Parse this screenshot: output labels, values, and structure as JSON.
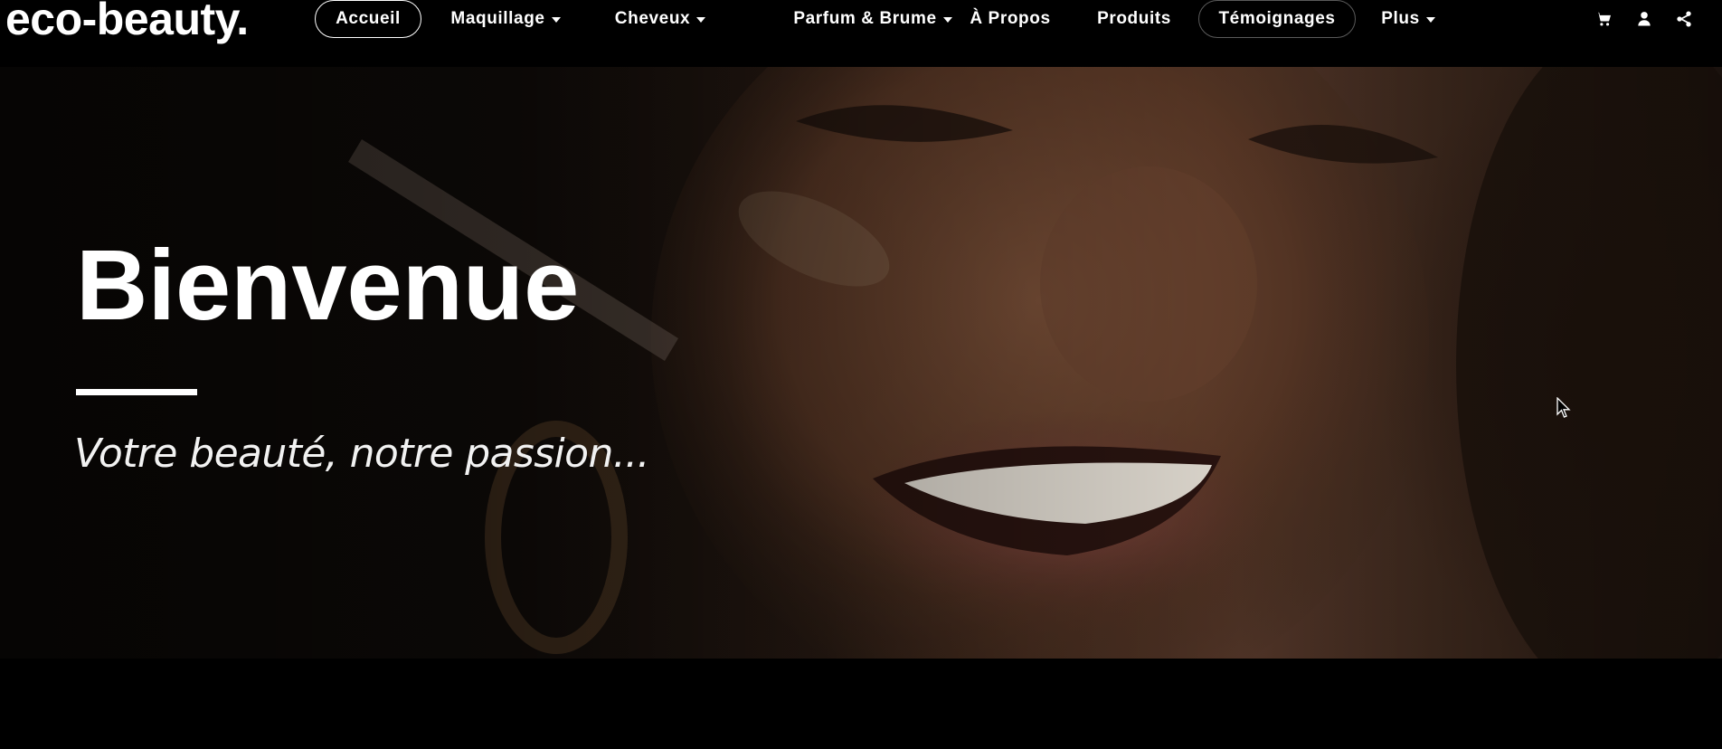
{
  "brand": {
    "logo": "eco-beauty."
  },
  "nav": {
    "items": [
      {
        "label": "Accueil",
        "active": true
      },
      {
        "label": "Maquillage",
        "dropdown": true
      },
      {
        "label": "Cheveux",
        "dropdown": true
      },
      {
        "label": "Parfum & Brume",
        "dropdown": true
      },
      {
        "label": "À Propos"
      },
      {
        "label": "Produits"
      },
      {
        "label": "Témoignages"
      },
      {
        "label": "Plus",
        "dropdown": true
      }
    ],
    "icons": [
      "cart-icon",
      "user-icon",
      "share-icon"
    ]
  },
  "hero": {
    "title": "Bienvenue",
    "subtitle": "Votre beauté, notre passion..."
  },
  "colors": {
    "background": "#000000",
    "text": "#ffffff"
  }
}
